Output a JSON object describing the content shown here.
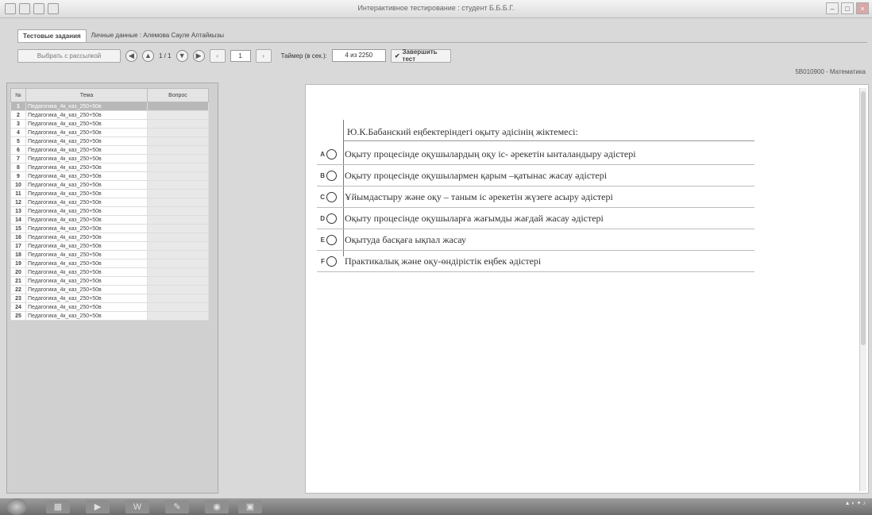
{
  "window": {
    "title": "Интерактивное тестирование : студент Б.Б.Б.Г."
  },
  "tabs": [
    {
      "label": "Тестовые задания",
      "active": true
    },
    {
      "label": "Личные данные : Алемова Сауле Алтайкызы",
      "active": false
    }
  ],
  "toolbar": {
    "select_label": "Выбрать с рассылкой",
    "page_indicator": "1 / 1",
    "page_value": "1",
    "timer_label": "Таймер (в сек.):",
    "timer_value": "4 из 2250",
    "finish_label": "Завершить тест"
  },
  "subject_code": "5B010900 - Математика",
  "question_list": {
    "headers": [
      "№",
      "Тема",
      "Вопрос"
    ],
    "rows": [
      {
        "num": "1",
        "topic": "Педагогика_4к_каз_250+50в"
      },
      {
        "num": "2",
        "topic": "Педагогика_4к_каз_250+50в"
      },
      {
        "num": "3",
        "topic": "Педагогика_4к_каз_250+50в"
      },
      {
        "num": "4",
        "topic": "Педагогика_4к_каз_250+50в"
      },
      {
        "num": "5",
        "topic": "Педагогика_4к_каз_250+50в"
      },
      {
        "num": "6",
        "topic": "Педагогика_4к_каз_250+50в"
      },
      {
        "num": "7",
        "topic": "Педагогика_4к_каз_250+50в"
      },
      {
        "num": "8",
        "topic": "Педагогика_4к_каз_250+50в"
      },
      {
        "num": "9",
        "topic": "Педагогика_4к_каз_250+50в"
      },
      {
        "num": "10",
        "topic": "Педагогика_4к_каз_250+50в"
      },
      {
        "num": "11",
        "topic": "Педагогика_4к_каз_250+50в"
      },
      {
        "num": "12",
        "topic": "Педагогика_4к_каз_250+50в"
      },
      {
        "num": "13",
        "topic": "Педагогика_4к_каз_250+50в"
      },
      {
        "num": "14",
        "topic": "Педагогика_4к_каз_250+50в"
      },
      {
        "num": "15",
        "topic": "Педагогика_4к_каз_250+50в"
      },
      {
        "num": "16",
        "topic": "Педагогика_4к_каз_250+50в"
      },
      {
        "num": "17",
        "topic": "Педагогика_4к_каз_250+50в"
      },
      {
        "num": "18",
        "topic": "Педагогика_4к_каз_250+50в"
      },
      {
        "num": "19",
        "topic": "Педагогика_4к_каз_250+50в"
      },
      {
        "num": "20",
        "topic": "Педагогика_4к_каз_250+50в"
      },
      {
        "num": "21",
        "topic": "Педагогика_4к_каз_250+50в"
      },
      {
        "num": "22",
        "topic": "Педагогика_4к_каз_250+50в"
      },
      {
        "num": "23",
        "topic": "Педагогика_4к_каз_250+50в"
      },
      {
        "num": "24",
        "topic": "Педагогика_4к_каз_250+50в"
      },
      {
        "num": "25",
        "topic": "Педагогика_4к_каз_250+50в"
      }
    ],
    "selected_index": 0
  },
  "question": {
    "text": "Ю.К.Бабанский еңбектеріндегі оқыту әдісінің жіктемесі:",
    "options": [
      {
        "letter": "A",
        "text": "Оқыту процесінде оқушылардың оқу іс- әрекетін ынталандыру әдістері"
      },
      {
        "letter": "B",
        "text": "Оқыту процесінде оқушылармен қарым –қатынас жасау әдістері"
      },
      {
        "letter": "C",
        "text": "Ұйымдастыру және оқу – таным іс әрекетін жүзеге асыру әдістері"
      },
      {
        "letter": "D",
        "text": "Оқыту процесінде оқушыларға жағымды жағдай жасау әдістері"
      },
      {
        "letter": "E",
        "text": "Оқытуда басқаға ықпал жасау"
      },
      {
        "letter": "F",
        "text": "Практикалық және оқу-өндірістік еңбек әдістері"
      }
    ]
  },
  "icons": {
    "prev": "◀",
    "next": "▶",
    "up": "▲",
    "down": "▼",
    "finish": "✔"
  }
}
